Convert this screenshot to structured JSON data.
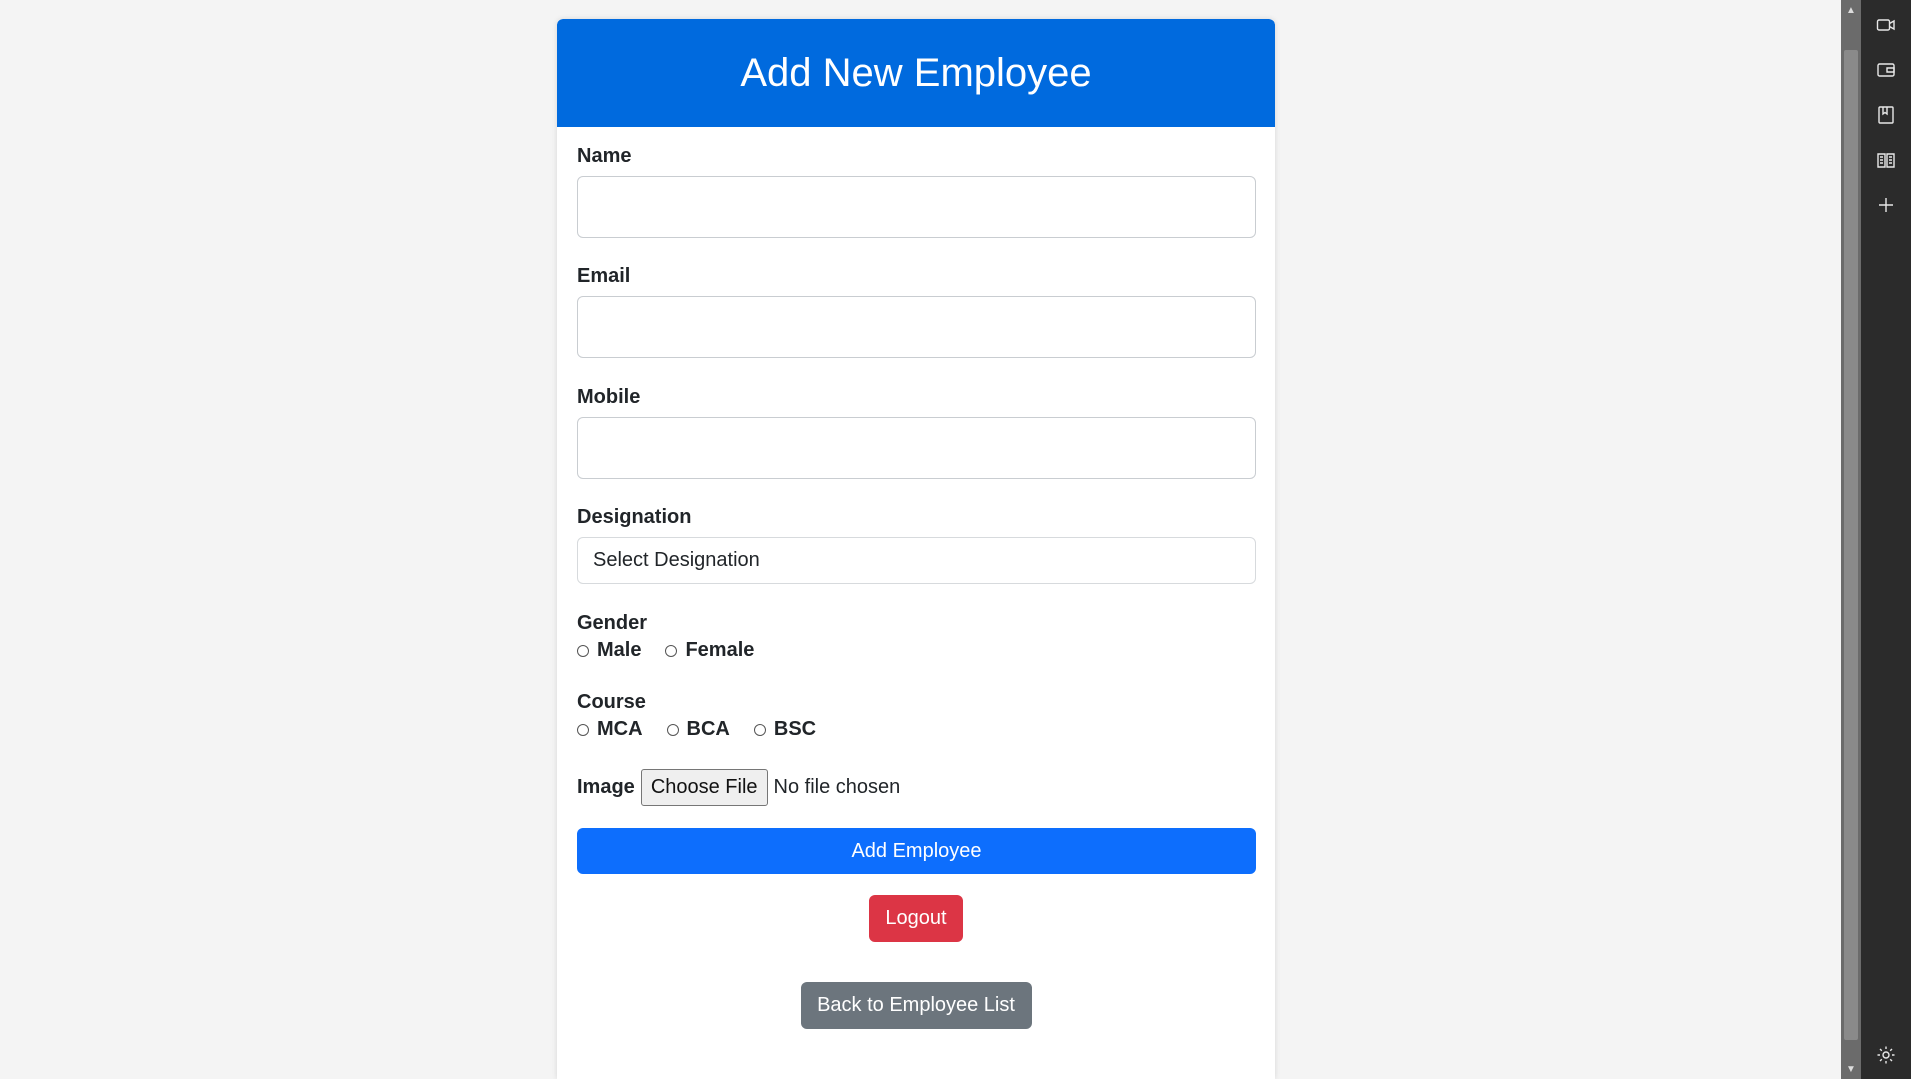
{
  "form": {
    "title": "Add New Employee",
    "fields": {
      "name_label": "Name",
      "email_label": "Email",
      "mobile_label": "Mobile",
      "designation_label": "Designation",
      "designation_value": "Select Designation",
      "gender_label": "Gender",
      "gender_options": [
        "Male",
        "Female"
      ],
      "course_label": "Course",
      "course_options": [
        "MCA",
        "BCA",
        "BSC"
      ],
      "image_label": "Image",
      "choose_file_label": "Choose File",
      "file_status": "No file chosen"
    },
    "buttons": {
      "add_employee": "Add Employee",
      "logout": "Logout",
      "back": "Back to Employee List"
    }
  },
  "sidebar": {
    "icons": [
      "video-icon",
      "wallet-icon",
      "bookmark-icon",
      "reader-icon",
      "add-icon",
      "settings-icon"
    ]
  },
  "colors": {
    "header": "#006ade",
    "primary_button": "#0d6efd",
    "danger_button": "#dc3545",
    "secondary_button": "#6c757d"
  }
}
